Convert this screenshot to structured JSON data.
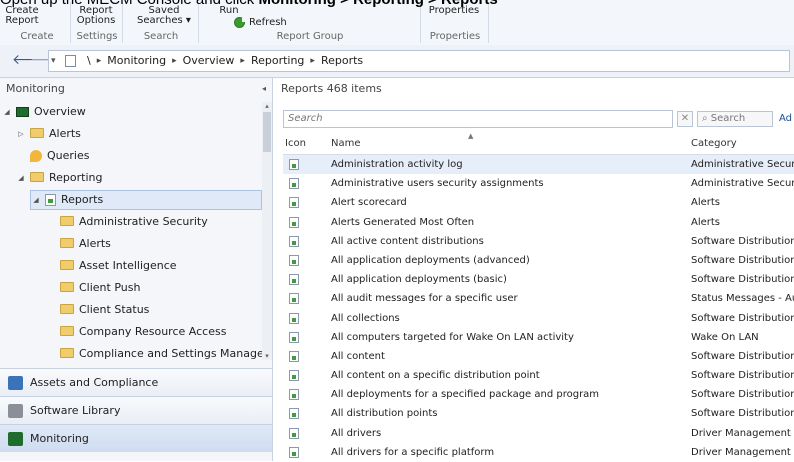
{
  "caption": {
    "prefix": "Open up the MECM Console and click ",
    "monitoring": "Monitoring",
    "sep1": " > ",
    "reporting": "Reporting",
    "sep2": " > ",
    "reports": "Reports"
  },
  "ribbon": {
    "buttons": [
      {
        "line1": "Create",
        "line2": "Report"
      },
      {
        "line1": "Report",
        "line2": "Options"
      },
      {
        "line1": "Saved",
        "line2": "Searches ▾"
      },
      {
        "line1": "Run",
        "line2": ""
      }
    ],
    "refresh_label": "Refresh",
    "properties_label": "Properties",
    "groups": [
      "Create",
      "Settings",
      "Search",
      "Report Group",
      "Properties"
    ]
  },
  "address": {
    "back": "🡐",
    "forward": "🡒",
    "dropdown": "▾",
    "root_sep": "\\",
    "crumbs": [
      "Monitoring",
      "Overview",
      "Reporting",
      "Reports"
    ]
  },
  "left_pane": {
    "title": "Monitoring",
    "tree": [
      {
        "label": "Overview"
      },
      {
        "label": "Alerts"
      },
      {
        "label": "Queries"
      },
      {
        "label": "Reporting"
      },
      {
        "label": "Reports"
      },
      {
        "label": "Administrative Security"
      },
      {
        "label": "Alerts"
      },
      {
        "label": "Asset Intelligence"
      },
      {
        "label": "Client Push"
      },
      {
        "label": "Client Status"
      },
      {
        "label": "Company Resource Access"
      },
      {
        "label": "Compliance and Settings Management"
      }
    ],
    "workspaces": [
      "Assets and Compliance",
      "Software Library",
      "Monitoring"
    ]
  },
  "right_pane": {
    "title": "Reports 468 items",
    "search_placeholder": "Search",
    "clear_label": "✕",
    "search_button": "Search",
    "add_label": "Ad",
    "columns": {
      "icon": "Icon",
      "name": "Name",
      "category": "Category"
    },
    "rows": [
      {
        "name": "Administration activity log",
        "category": "Administrative Security"
      },
      {
        "name": "Administrative users security assignments",
        "category": "Administrative Security"
      },
      {
        "name": "Alert scorecard",
        "category": "Alerts"
      },
      {
        "name": "Alerts Generated Most Often",
        "category": "Alerts"
      },
      {
        "name": "All active content distributions",
        "category": "Software Distribution -"
      },
      {
        "name": "All application deployments (advanced)",
        "category": "Software Distribution -"
      },
      {
        "name": "All application deployments (basic)",
        "category": "Software Distribution -"
      },
      {
        "name": "All audit messages for a specific user",
        "category": "Status Messages - Aud"
      },
      {
        "name": "All collections",
        "category": "Software Distribution -"
      },
      {
        "name": "All computers targeted for Wake On LAN activity",
        "category": "Wake On LAN"
      },
      {
        "name": "All content",
        "category": "Software Distribution -"
      },
      {
        "name": "All content on a specific distribution point",
        "category": "Software Distribution -"
      },
      {
        "name": "All deployments for a specified package and program",
        "category": "Software Distribution -"
      },
      {
        "name": "All distribution points",
        "category": "Software Distribution -"
      },
      {
        "name": "All drivers",
        "category": "Driver Management"
      },
      {
        "name": "All drivers for a specific platform",
        "category": "Driver Management"
      }
    ]
  }
}
